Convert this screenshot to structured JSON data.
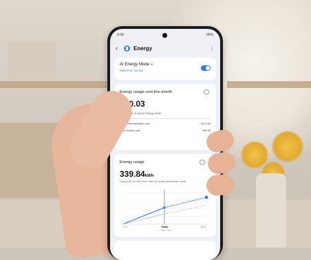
{
  "status_bar": {
    "time": "9:34",
    "battery": "95%"
  },
  "app_bar": {
    "title": "Energy"
  },
  "ai_mode": {
    "title": "AI Energy Mode",
    "subtitle": "Maximum saving",
    "enabled": true
  },
  "cost_card": {
    "title": "Energy usage cost this month",
    "amount": "€70.03",
    "saving_note": "Saving € 11 with AI Energy Mode",
    "rows": [
      {
        "label": "Full-month estimated cost",
        "value": "€114.99"
      },
      {
        "label": "Last month's cost",
        "value": "€68.05"
      }
    ]
  },
  "usage_card": {
    "title": "Energy usage",
    "amount": "339.84",
    "unit": "kWh",
    "note": "Using 155.02 kWh more than the same period last month."
  },
  "chart_data": {
    "type": "line",
    "x": [
      "Jul 1",
      "Today",
      "Jul 31"
    ],
    "series": [
      {
        "name": "This",
        "values": [
          0,
          210,
          340
        ]
      },
      {
        "name": "Last",
        "values": [
          0,
          130,
          240
        ]
      }
    ],
    "ylim": [
      0,
      400
    ],
    "legend": [
      "This",
      "Last"
    ]
  },
  "colors": {
    "accent": "#2f7bf1",
    "leaf": "#34c07a"
  }
}
